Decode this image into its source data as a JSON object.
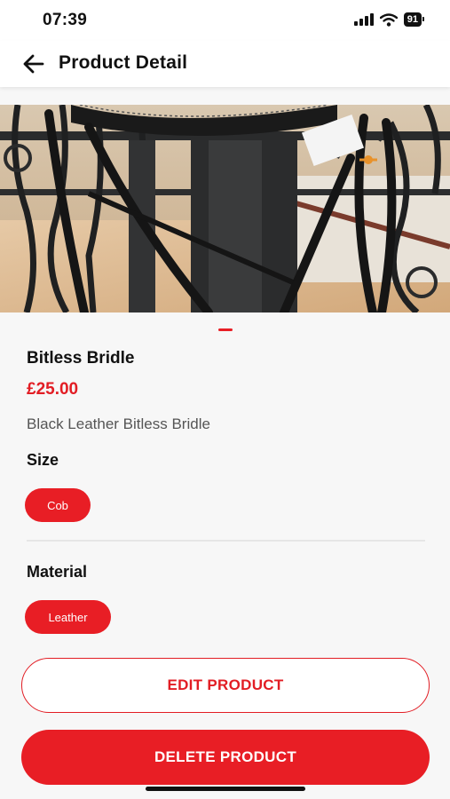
{
  "status_bar": {
    "time": "07:39",
    "battery": "91"
  },
  "header": {
    "title": "Product Detail"
  },
  "product": {
    "name": "Bitless Bridle",
    "price": "£25.00",
    "description": "Black Leather Bitless Bridle"
  },
  "size": {
    "label": "Size",
    "options": [
      "Cob"
    ]
  },
  "material": {
    "label": "Material",
    "options": [
      "Leather"
    ]
  },
  "actions": {
    "edit_label": "EDIT PRODUCT",
    "delete_label": "DELETE PRODUCT"
  },
  "colors": {
    "accent": "#e81e25",
    "price": "#e21d24"
  }
}
